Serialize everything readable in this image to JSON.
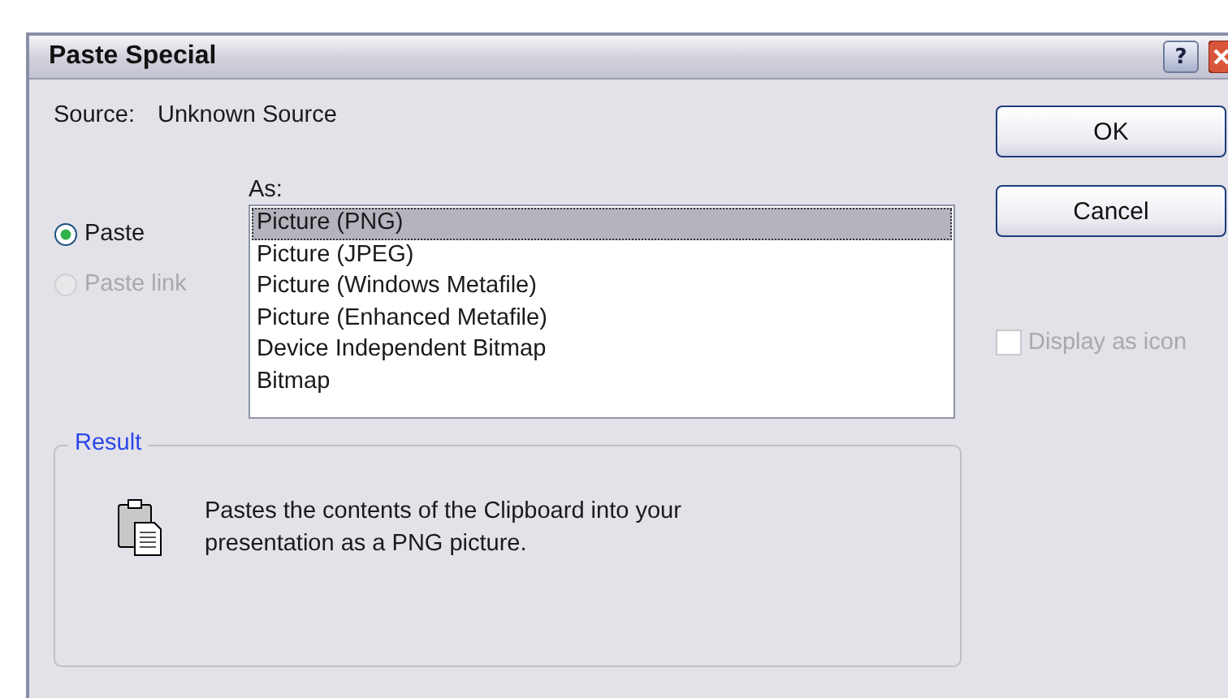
{
  "window": {
    "title": "Paste Special",
    "help_button": "?"
  },
  "source": {
    "label": "Source:",
    "value": "Unknown Source"
  },
  "paste_options": [
    {
      "label": "Paste",
      "selected": true,
      "disabled": false
    },
    {
      "label": "Paste link",
      "selected": false,
      "disabled": true
    }
  ],
  "as_list": {
    "label": "As:",
    "items": [
      {
        "label": "Picture (PNG)",
        "selected": true
      },
      {
        "label": "Picture (JPEG)",
        "selected": false
      },
      {
        "label": "Picture (Windows Metafile)",
        "selected": false
      },
      {
        "label": "Picture (Enhanced Metafile)",
        "selected": false
      },
      {
        "label": "Device Independent Bitmap",
        "selected": false
      },
      {
        "label": "Bitmap",
        "selected": false
      }
    ]
  },
  "buttons": [
    {
      "label": "OK"
    },
    {
      "label": "Cancel"
    }
  ],
  "display_as_icon": {
    "label": "Display as icon",
    "checked": false,
    "disabled": true
  },
  "result": {
    "title": "Result",
    "description": "Pastes the contents of the Clipboard into your presentation as a PNG picture."
  }
}
